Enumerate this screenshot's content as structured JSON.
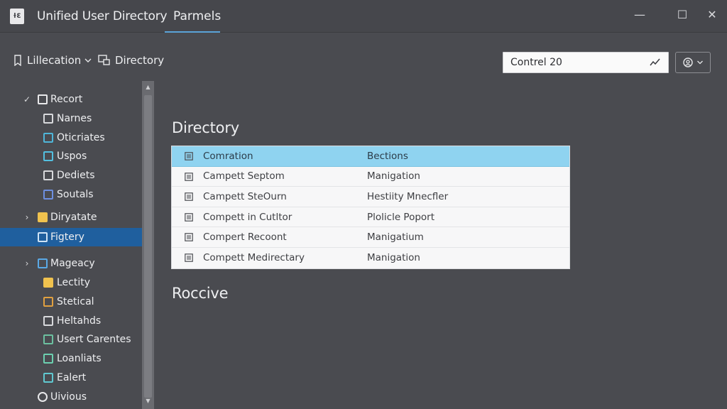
{
  "window": {
    "app_icon_text": "ɫƐ",
    "title": "Unified User Directory",
    "tab_label": "Parmels",
    "minimize_glyph": "—",
    "maximize_glyph": "☐",
    "close_glyph": "✕"
  },
  "toolbar": {
    "allocation_label": "Lillecation",
    "directory_label": "Directory",
    "search_value": "Contrel 20",
    "search_icon": "trend-line-icon",
    "profile_icon": "user-circle-icon"
  },
  "sidebar": {
    "items": [
      {
        "label": "Recort",
        "chevron": "✓",
        "icon": "document-icon",
        "color": "#e8e8ea"
      },
      {
        "label": "Narnes",
        "icon": "grid-icon",
        "color": "#d8d9dc"
      },
      {
        "label": "Oticriates",
        "icon": "square-icon",
        "color": "#4fb6d9"
      },
      {
        "label": "Uspos",
        "icon": "list-icon",
        "color": "#53c0e0"
      },
      {
        "label": "Dediets",
        "icon": "table-icon",
        "color": "#d8d9dc"
      },
      {
        "label": "Soutals",
        "icon": "image-icon",
        "color": "#6d8fe0"
      },
      {
        "label": "Diryatate",
        "chevron": "›",
        "icon": "folder-icon",
        "color": "#f0c24e"
      },
      {
        "label": "Figtery",
        "icon": "monitor-icon",
        "color": "#cfe3f5"
      },
      {
        "label": "Mageacy",
        "chevron": "›",
        "icon": "gallery-icon",
        "color": "#5aa9e6"
      },
      {
        "label": "Lectity",
        "icon": "folder-icon",
        "color": "#f0c24e"
      },
      {
        "label": "Stetical",
        "icon": "palette-icon",
        "color": "#e0a040"
      },
      {
        "label": "Heltahds",
        "icon": "window-icon",
        "color": "#d8d9dc"
      },
      {
        "label": "Usert Carentes",
        "icon": "user-card-icon",
        "color": "#6cc0a0"
      },
      {
        "label": "Loanliats",
        "icon": "pen-icon",
        "color": "#6cd0b0"
      },
      {
        "label": "Ealert",
        "icon": "notes-icon",
        "color": "#60c8d0"
      },
      {
        "label": "Uivious",
        "icon": "circle-icon",
        "color": "#e8e8ea"
      }
    ]
  },
  "main": {
    "directory_title": "Directory",
    "table": {
      "headers": [
        "Comration",
        "Bections"
      ],
      "rows": [
        [
          "Campett Septom",
          "Manigation"
        ],
        [
          "Campett SteOurn",
          "Hestiity Mnecfler"
        ],
        [
          "Compett in Cutltor",
          "Plolicle Poport"
        ],
        [
          "Compert Recoont",
          "Manigatium"
        ],
        [
          "Compett Medirectary",
          "Manigation"
        ]
      ]
    },
    "second_title": "Roccive"
  },
  "colors": {
    "background": "#4a4b50",
    "selected": "#1f5f9e",
    "header_row": "#8fd3f0",
    "accent": "#5aa3d8"
  }
}
